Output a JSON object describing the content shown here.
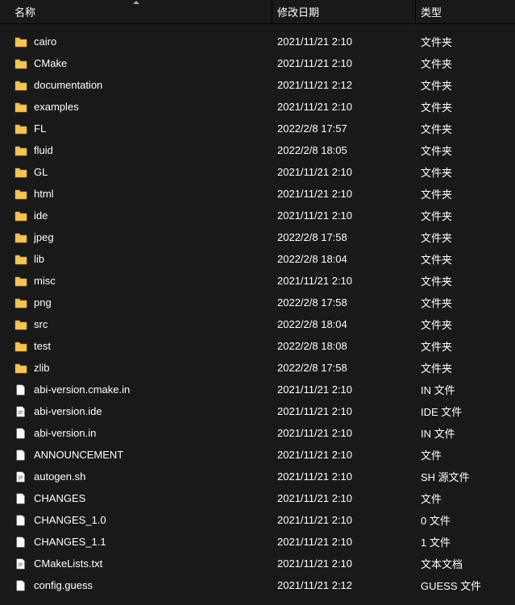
{
  "header": {
    "name": "名称",
    "date": "修改日期",
    "type": "类型"
  },
  "rows": [
    {
      "icon": "folder",
      "name": "cairo",
      "date": "2021/11/21 2:10",
      "type": "文件夹"
    },
    {
      "icon": "folder",
      "name": "CMake",
      "date": "2021/11/21 2:10",
      "type": "文件夹"
    },
    {
      "icon": "folder",
      "name": "documentation",
      "date": "2021/11/21 2:12",
      "type": "文件夹"
    },
    {
      "icon": "folder",
      "name": "examples",
      "date": "2021/11/21 2:10",
      "type": "文件夹"
    },
    {
      "icon": "folder",
      "name": "FL",
      "date": "2022/2/8 17:57",
      "type": "文件夹"
    },
    {
      "icon": "folder",
      "name": "fluid",
      "date": "2022/2/8 18:05",
      "type": "文件夹"
    },
    {
      "icon": "folder",
      "name": "GL",
      "date": "2021/11/21 2:10",
      "type": "文件夹"
    },
    {
      "icon": "folder",
      "name": "html",
      "date": "2021/11/21 2:10",
      "type": "文件夹"
    },
    {
      "icon": "folder",
      "name": "ide",
      "date": "2021/11/21 2:10",
      "type": "文件夹"
    },
    {
      "icon": "folder",
      "name": "jpeg",
      "date": "2022/2/8 17:58",
      "type": "文件夹"
    },
    {
      "icon": "folder",
      "name": "lib",
      "date": "2022/2/8 18:04",
      "type": "文件夹"
    },
    {
      "icon": "folder",
      "name": "misc",
      "date": "2021/11/21 2:10",
      "type": "文件夹"
    },
    {
      "icon": "folder",
      "name": "png",
      "date": "2022/2/8 17:58",
      "type": "文件夹"
    },
    {
      "icon": "folder",
      "name": "src",
      "date": "2022/2/8 18:04",
      "type": "文件夹"
    },
    {
      "icon": "folder",
      "name": "test",
      "date": "2022/2/8 18:08",
      "type": "文件夹"
    },
    {
      "icon": "folder",
      "name": "zlib",
      "date": "2022/2/8 17:58",
      "type": "文件夹"
    },
    {
      "icon": "file",
      "name": "abi-version.cmake.in",
      "date": "2021/11/21 2:10",
      "type": "IN 文件"
    },
    {
      "icon": "file-text",
      "name": "abi-version.ide",
      "date": "2021/11/21 2:10",
      "type": "IDE 文件"
    },
    {
      "icon": "file",
      "name": "abi-version.in",
      "date": "2021/11/21 2:10",
      "type": "IN 文件"
    },
    {
      "icon": "file",
      "name": "ANNOUNCEMENT",
      "date": "2021/11/21 2:10",
      "type": "文件"
    },
    {
      "icon": "file-text",
      "name": "autogen.sh",
      "date": "2021/11/21 2:10",
      "type": "SH 源文件"
    },
    {
      "icon": "file",
      "name": "CHANGES",
      "date": "2021/11/21 2:10",
      "type": "文件"
    },
    {
      "icon": "file",
      "name": "CHANGES_1.0",
      "date": "2021/11/21 2:10",
      "type": "0 文件"
    },
    {
      "icon": "file",
      "name": "CHANGES_1.1",
      "date": "2021/11/21 2:10",
      "type": "1 文件"
    },
    {
      "icon": "file-text",
      "name": "CMakeLists.txt",
      "date": "2021/11/21 2:10",
      "type": "文本文档"
    },
    {
      "icon": "file",
      "name": "config.guess",
      "date": "2021/11/21 2:12",
      "type": "GUESS 文件"
    }
  ]
}
